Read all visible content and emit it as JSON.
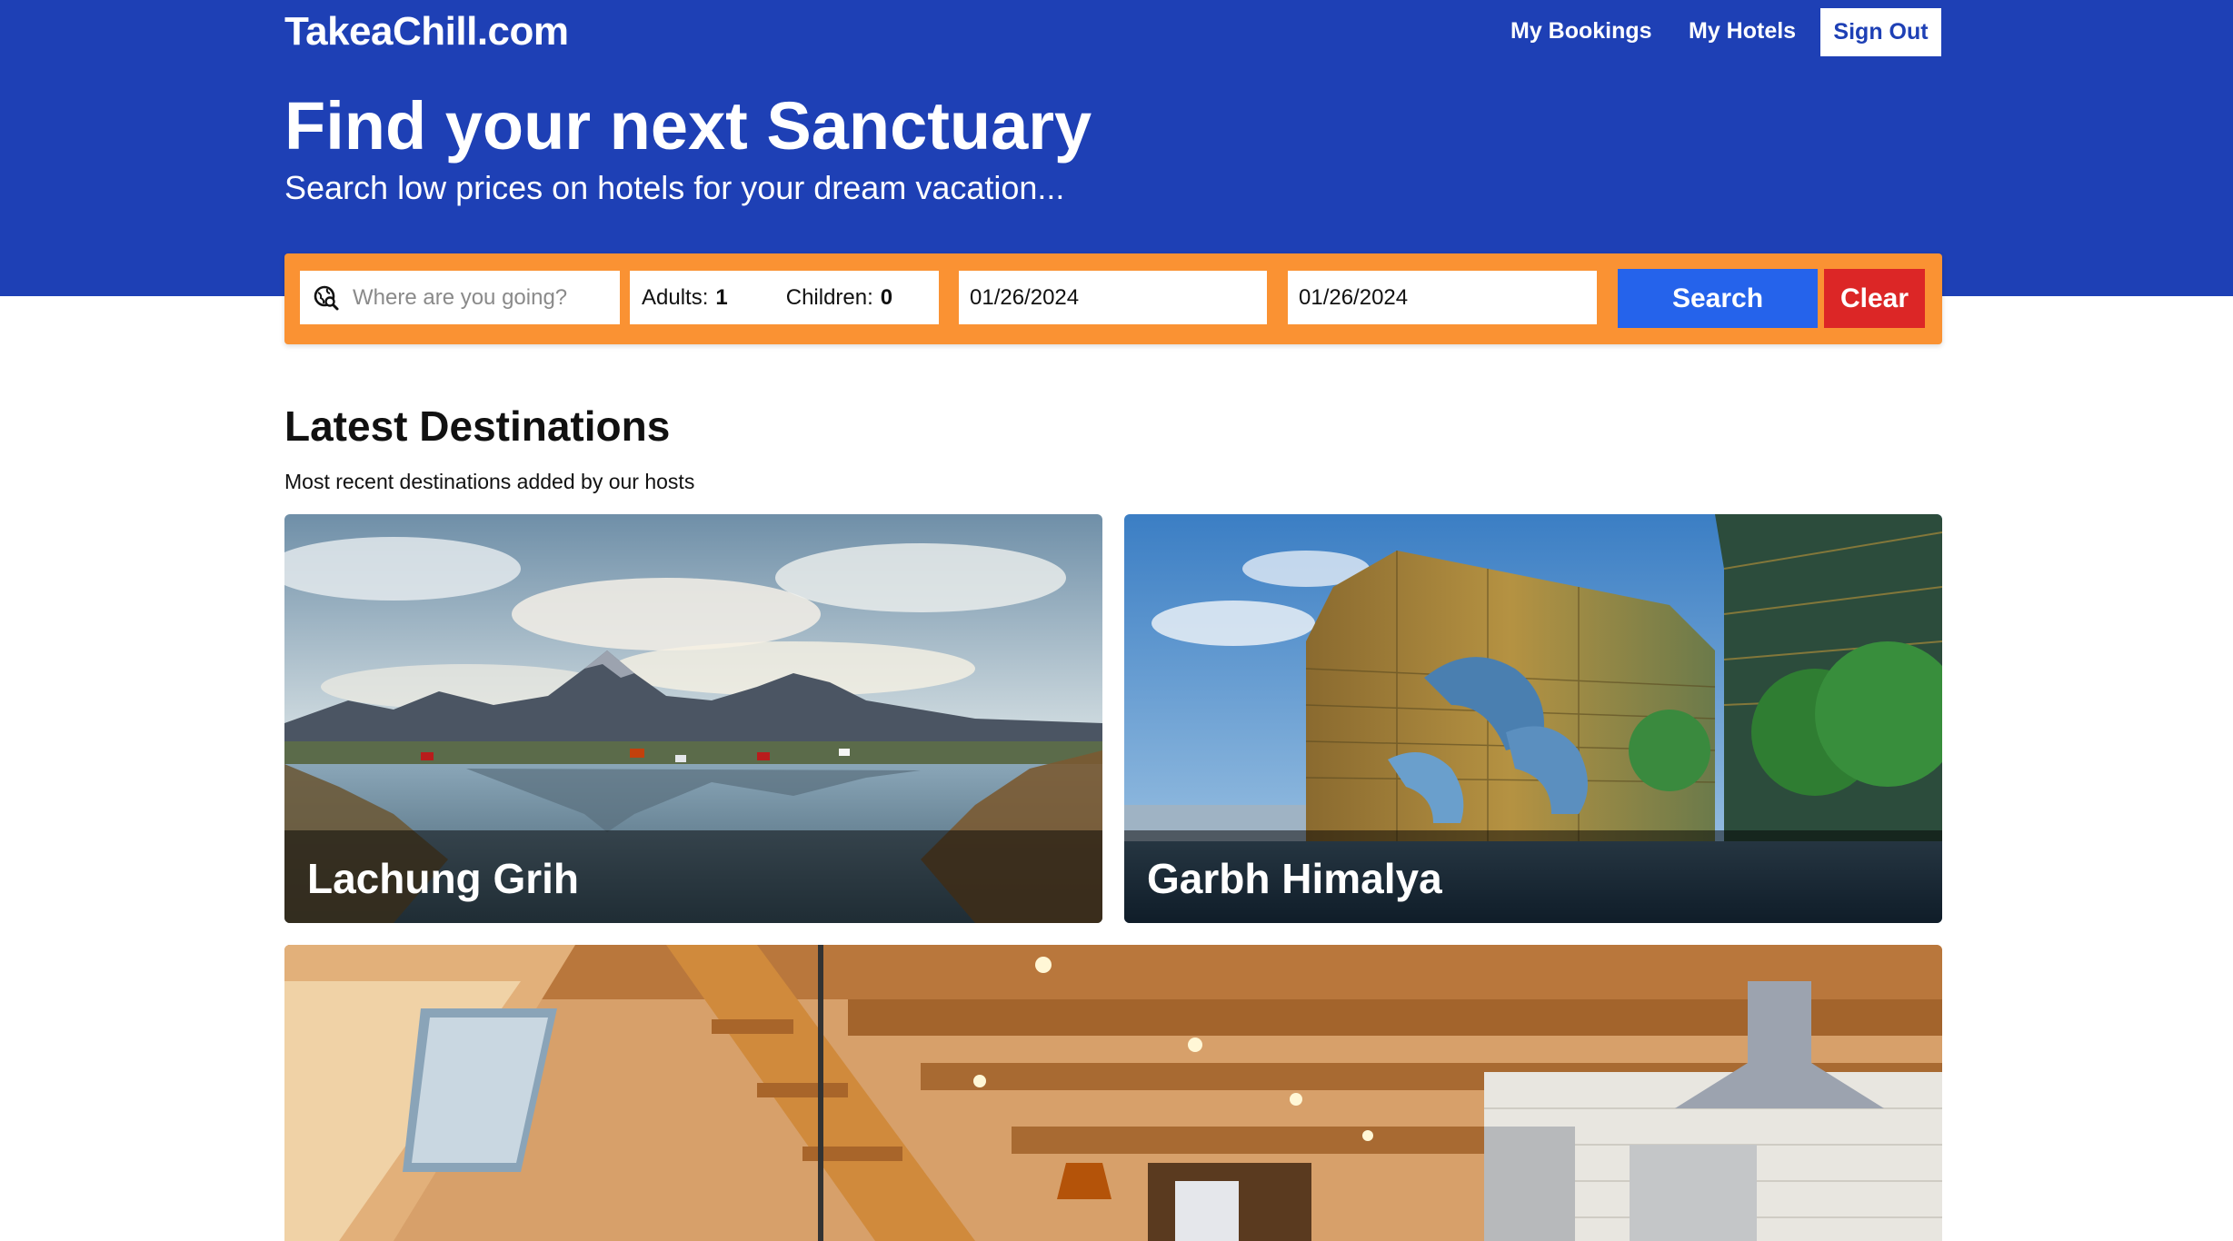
{
  "header": {
    "logo": "TakeaChill.com",
    "nav": {
      "bookings": "My Bookings",
      "hotels": "My Hotels",
      "signout": "Sign Out"
    },
    "title": "Find your next Sanctuary",
    "subtitle": "Search low prices on hotels for your dream vacation..."
  },
  "search": {
    "destination_placeholder": "Where are you going?",
    "adults_label": "Adults:",
    "adults_value": "1",
    "children_label": "Children:",
    "children_value": "0",
    "checkin": "01/26/2024",
    "checkout": "01/26/2024",
    "search_label": "Search",
    "clear_label": "Clear",
    "icon": "globe-search-icon"
  },
  "latest": {
    "title": "Latest Destinations",
    "subtitle": "Most recent destinations added by our hosts",
    "cards": [
      {
        "name": "Lachung Grih",
        "image": "mountain-lake-village-photo"
      },
      {
        "name": "Garbh Himalya",
        "image": "city-hotel-dolphin-fountain-photo"
      },
      {
        "name": "",
        "image": "wooden-cabin-interior-photo"
      }
    ]
  },
  "colors": {
    "header_bg": "#1e40b5",
    "search_border": "#fa9233",
    "search_button": "#2563eb",
    "clear_button": "#dc2626"
  }
}
